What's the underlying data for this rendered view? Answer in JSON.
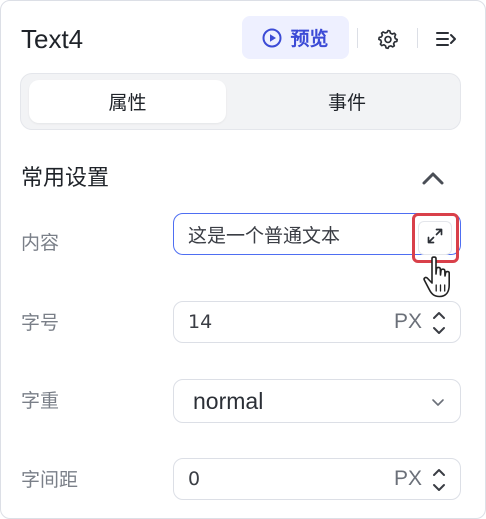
{
  "header": {
    "title": "Text4",
    "preview_label": "预览",
    "icons": [
      "play-circle-icon",
      "gear-icon",
      "collapse-panel-icon"
    ]
  },
  "tabs": [
    {
      "label": "属性",
      "active": true
    },
    {
      "label": "事件",
      "active": false
    }
  ],
  "section": {
    "title": "常用设置",
    "toggle_icon": "chevron-up-icon"
  },
  "fields": {
    "content": {
      "label": "内容",
      "value": "这是一个普通文本",
      "action_icon": "expand-icon"
    },
    "font_size": {
      "label": "字号",
      "value": "14",
      "unit": "PX"
    },
    "font_weight": {
      "label": "字重",
      "value": "normal"
    },
    "letter_spacing": {
      "label": "字间距",
      "value": "0",
      "unit": "PX"
    }
  },
  "colors": {
    "accent": "#3c4bd6",
    "accent_bg": "#eef0ff",
    "focus_border": "#4e6ef2",
    "highlight": "#d9404a"
  }
}
